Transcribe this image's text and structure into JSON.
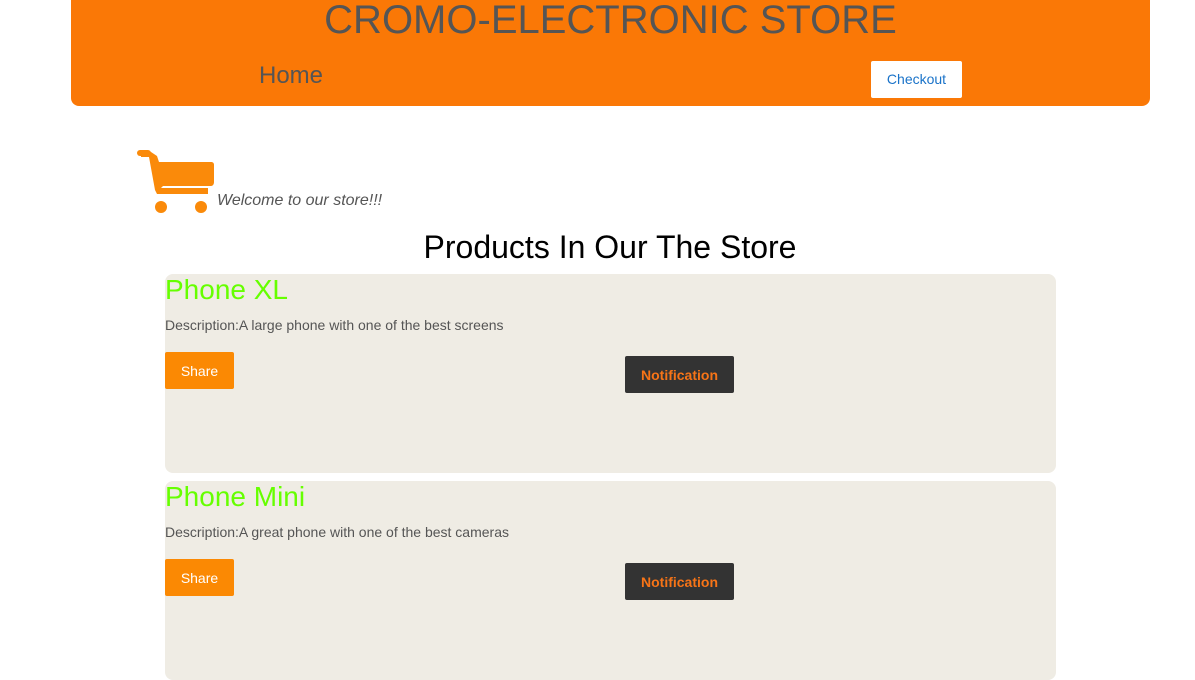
{
  "header": {
    "title": "CROMO-ELECTRONIC STORE",
    "nav_home": "Home",
    "checkout_label": "Checkout"
  },
  "cart_icon": "shopping-cart-icon",
  "welcome_text": "Welcome to our store!!!",
  "products_heading": "Products In Our The Store",
  "products": [
    {
      "name": "Phone XL",
      "description": "Description:A large phone with one of the best screens",
      "share_label": "Share",
      "notification_label": "Notification"
    },
    {
      "name": "Phone Mini",
      "description": "Description:A great phone with one of the best cameras",
      "share_label": "Share",
      "notification_label": "Notification"
    }
  ],
  "colors": {
    "header_bg": "#fa7806",
    "card_bg": "#efece4",
    "product_name": "#66ff00",
    "share_bg": "#fb8903",
    "notification_bg": "#333333",
    "notification_text": "#f77417",
    "checkout_text": "#1a73c9"
  }
}
